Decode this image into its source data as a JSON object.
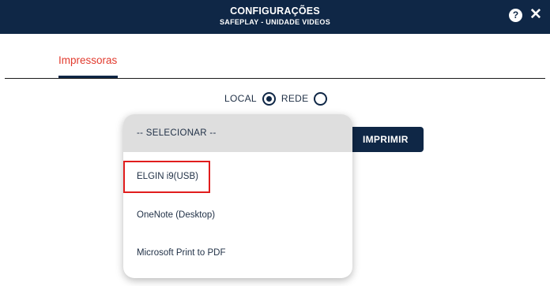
{
  "header": {
    "title": "CONFIGURAÇÕES",
    "subtitle": "SAFEPLAY - UNIDADE VIDEOS",
    "help_label": "?",
    "close_label": "✕"
  },
  "tabs": [
    {
      "label": "Impressoras",
      "active": true
    }
  ],
  "mode": {
    "local_label": "LOCAL",
    "rede_label": "REDE",
    "selected": "LOCAL"
  },
  "print_button": {
    "label": "IMPRIMIR"
  },
  "printer_dropdown": {
    "options": [
      "-- SELECIONAR --",
      "ELGIN i9(USB)",
      "OneNote (Desktop)",
      "Microsoft Print to PDF"
    ],
    "current": "-- SELECIONAR --",
    "highlighted": "ELGIN i9(USB)"
  },
  "colors": {
    "header_bg": "#0f2746",
    "accent_red": "#e23b2e",
    "highlight_box": "#e11d1d",
    "selected_option_bg": "#dedede"
  }
}
